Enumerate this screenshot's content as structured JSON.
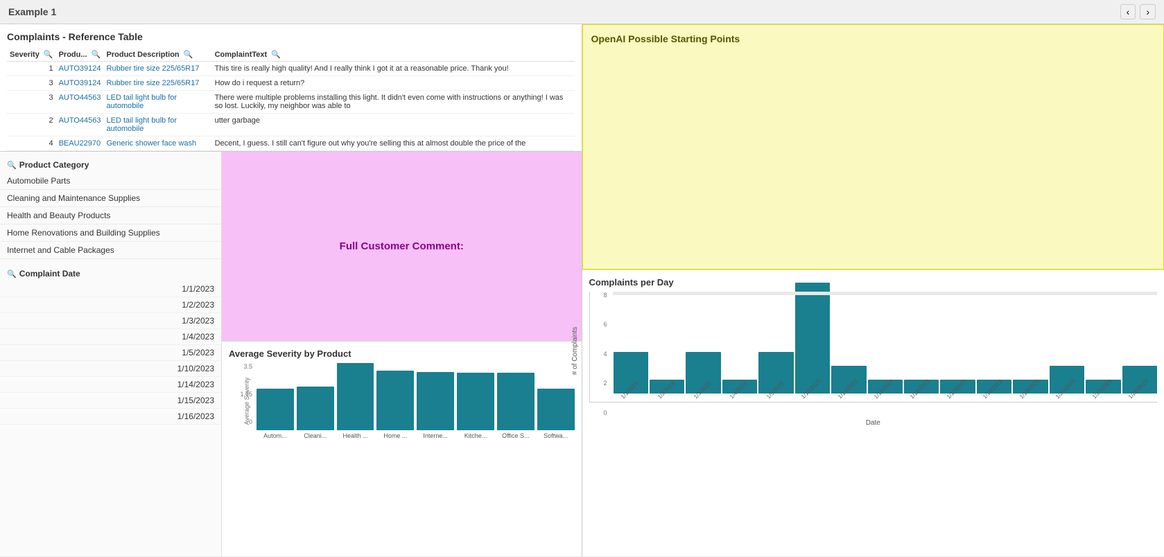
{
  "topbar": {
    "title": "Example 1",
    "prev_btn": "‹",
    "next_btn": "›"
  },
  "ref_table": {
    "title": "Complaints - Reference Table",
    "columns": [
      {
        "label": "Severity",
        "key": "severity"
      },
      {
        "label": "Produ...",
        "key": "product_id"
      },
      {
        "label": "Product Description",
        "key": "product_desc"
      },
      {
        "label": "ComplaintText",
        "key": "complaint_text"
      }
    ],
    "rows": [
      {
        "severity": "1",
        "product_id": "AUTO39124",
        "product_desc": "Rubber tire size 225/65R17",
        "complaint_text": "This tire is really high quality! And I really think I got it at a reasonable price. Thank you!"
      },
      {
        "severity": "3",
        "product_id": "AUTO39124",
        "product_desc": "Rubber tire size 225/65R17",
        "complaint_text": "How do i request a return?"
      },
      {
        "severity": "3",
        "product_id": "AUTO44563",
        "product_desc": "LED tail light bulb for automobile",
        "complaint_text": "There were multiple problems installing this light. It didn't even come with instructions or anything! I was so lost. Luckily, my neighbor was able to"
      },
      {
        "severity": "2",
        "product_id": "AUTO44563",
        "product_desc": "LED tail light bulb for automobile",
        "complaint_text": "utter garbage"
      },
      {
        "severity": "4",
        "product_id": "BEAU22970",
        "product_desc": "Generic shower face wash",
        "complaint_text": "Decent, I guess. I still can't figure out why you're selling this at almost double the price of the"
      }
    ]
  },
  "product_category_filter": {
    "title": "Product Category",
    "items": [
      {
        "label": "Automobile Parts"
      },
      {
        "label": "Cleaning and Maintenance Supplies"
      },
      {
        "label": "Health and Beauty Products"
      },
      {
        "label": "Home Renovations and Building Supplies"
      },
      {
        "label": "Internet and Cable Packages"
      }
    ]
  },
  "complaint_date_filter": {
    "title": "Complaint Date",
    "dates": [
      "1/1/2023",
      "1/2/2023",
      "1/3/2023",
      "1/4/2023",
      "1/5/2023",
      "1/10/2023",
      "1/14/2023",
      "1/15/2023",
      "1/16/2023"
    ]
  },
  "full_comment": {
    "label": "Full Customer Comment:"
  },
  "avg_severity_chart": {
    "title": "Average Severity by Product",
    "y_axis_label": "Average Severity",
    "y_ticks": [
      "3.5",
      "",
      "1.75",
      "",
      "0"
    ],
    "bars": [
      {
        "label": "Autom...",
        "value": 2.1
      },
      {
        "label": "Cleani...",
        "value": 2.2
      },
      {
        "label": "Health ...",
        "value": 3.4
      },
      {
        "label": "Home ...",
        "value": 3.0
      },
      {
        "label": "Interne...",
        "value": 2.95
      },
      {
        "label": "Kitche...",
        "value": 2.9
      },
      {
        "label": "Office S...",
        "value": 2.9
      },
      {
        "label": "Softwa...",
        "value": 2.1
      }
    ],
    "max_value": 3.5
  },
  "openai_section": {
    "title": "OpenAI Possible Starting Points"
  },
  "complaints_per_day": {
    "title": "Complaints per Day",
    "y_axis_label": "# of Complaints",
    "x_axis_label": "Date",
    "y_ticks": [
      "8",
      "6",
      "4",
      "2",
      "0"
    ],
    "bars": [
      {
        "label": "1/1/2023",
        "value": 3
      },
      {
        "label": "1/2/2023",
        "value": 1
      },
      {
        "label": "1/3/2023",
        "value": 3
      },
      {
        "label": "1/4/2023",
        "value": 1
      },
      {
        "label": "1/5/2023",
        "value": 3
      },
      {
        "label": "1/10/2023",
        "value": 8
      },
      {
        "label": "1/14/2023",
        "value": 2
      },
      {
        "label": "1/15/2023",
        "value": 1
      },
      {
        "label": "1/16/2023",
        "value": 1
      },
      {
        "label": "1/17/2023",
        "value": 1
      },
      {
        "label": "1/18/2023",
        "value": 1
      },
      {
        "label": "1/19/2023",
        "value": 1
      },
      {
        "label": "1/21/2023",
        "value": 2
      },
      {
        "label": "1/27/2023",
        "value": 1
      },
      {
        "label": "1/28/2023",
        "value": 2
      }
    ],
    "max_value": 8
  }
}
